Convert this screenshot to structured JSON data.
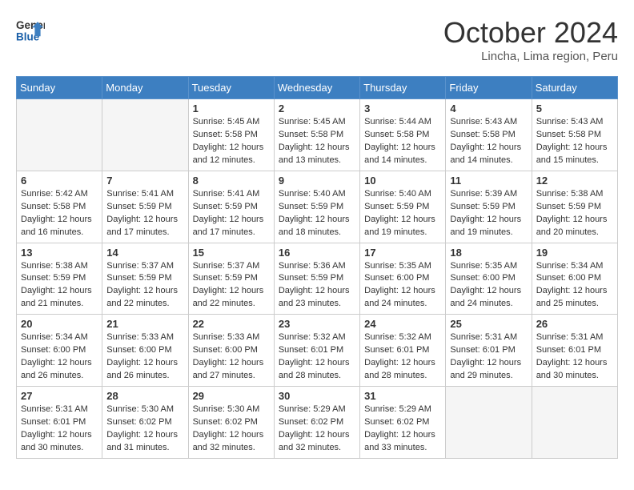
{
  "header": {
    "logo_line1": "General",
    "logo_line2": "Blue",
    "month": "October 2024",
    "location": "Lincha, Lima region, Peru"
  },
  "weekdays": [
    "Sunday",
    "Monday",
    "Tuesday",
    "Wednesday",
    "Thursday",
    "Friday",
    "Saturday"
  ],
  "weeks": [
    [
      {
        "day": "",
        "info": ""
      },
      {
        "day": "",
        "info": ""
      },
      {
        "day": "1",
        "info": "Sunrise: 5:45 AM\nSunset: 5:58 PM\nDaylight: 12 hours\nand 12 minutes."
      },
      {
        "day": "2",
        "info": "Sunrise: 5:45 AM\nSunset: 5:58 PM\nDaylight: 12 hours\nand 13 minutes."
      },
      {
        "day": "3",
        "info": "Sunrise: 5:44 AM\nSunset: 5:58 PM\nDaylight: 12 hours\nand 14 minutes."
      },
      {
        "day": "4",
        "info": "Sunrise: 5:43 AM\nSunset: 5:58 PM\nDaylight: 12 hours\nand 14 minutes."
      },
      {
        "day": "5",
        "info": "Sunrise: 5:43 AM\nSunset: 5:58 PM\nDaylight: 12 hours\nand 15 minutes."
      }
    ],
    [
      {
        "day": "6",
        "info": "Sunrise: 5:42 AM\nSunset: 5:58 PM\nDaylight: 12 hours\nand 16 minutes."
      },
      {
        "day": "7",
        "info": "Sunrise: 5:41 AM\nSunset: 5:59 PM\nDaylight: 12 hours\nand 17 minutes."
      },
      {
        "day": "8",
        "info": "Sunrise: 5:41 AM\nSunset: 5:59 PM\nDaylight: 12 hours\nand 17 minutes."
      },
      {
        "day": "9",
        "info": "Sunrise: 5:40 AM\nSunset: 5:59 PM\nDaylight: 12 hours\nand 18 minutes."
      },
      {
        "day": "10",
        "info": "Sunrise: 5:40 AM\nSunset: 5:59 PM\nDaylight: 12 hours\nand 19 minutes."
      },
      {
        "day": "11",
        "info": "Sunrise: 5:39 AM\nSunset: 5:59 PM\nDaylight: 12 hours\nand 19 minutes."
      },
      {
        "day": "12",
        "info": "Sunrise: 5:38 AM\nSunset: 5:59 PM\nDaylight: 12 hours\nand 20 minutes."
      }
    ],
    [
      {
        "day": "13",
        "info": "Sunrise: 5:38 AM\nSunset: 5:59 PM\nDaylight: 12 hours\nand 21 minutes."
      },
      {
        "day": "14",
        "info": "Sunrise: 5:37 AM\nSunset: 5:59 PM\nDaylight: 12 hours\nand 22 minutes."
      },
      {
        "day": "15",
        "info": "Sunrise: 5:37 AM\nSunset: 5:59 PM\nDaylight: 12 hours\nand 22 minutes."
      },
      {
        "day": "16",
        "info": "Sunrise: 5:36 AM\nSunset: 5:59 PM\nDaylight: 12 hours\nand 23 minutes."
      },
      {
        "day": "17",
        "info": "Sunrise: 5:35 AM\nSunset: 6:00 PM\nDaylight: 12 hours\nand 24 minutes."
      },
      {
        "day": "18",
        "info": "Sunrise: 5:35 AM\nSunset: 6:00 PM\nDaylight: 12 hours\nand 24 minutes."
      },
      {
        "day": "19",
        "info": "Sunrise: 5:34 AM\nSunset: 6:00 PM\nDaylight: 12 hours\nand 25 minutes."
      }
    ],
    [
      {
        "day": "20",
        "info": "Sunrise: 5:34 AM\nSunset: 6:00 PM\nDaylight: 12 hours\nand 26 minutes."
      },
      {
        "day": "21",
        "info": "Sunrise: 5:33 AM\nSunset: 6:00 PM\nDaylight: 12 hours\nand 26 minutes."
      },
      {
        "day": "22",
        "info": "Sunrise: 5:33 AM\nSunset: 6:00 PM\nDaylight: 12 hours\nand 27 minutes."
      },
      {
        "day": "23",
        "info": "Sunrise: 5:32 AM\nSunset: 6:01 PM\nDaylight: 12 hours\nand 28 minutes."
      },
      {
        "day": "24",
        "info": "Sunrise: 5:32 AM\nSunset: 6:01 PM\nDaylight: 12 hours\nand 28 minutes."
      },
      {
        "day": "25",
        "info": "Sunrise: 5:31 AM\nSunset: 6:01 PM\nDaylight: 12 hours\nand 29 minutes."
      },
      {
        "day": "26",
        "info": "Sunrise: 5:31 AM\nSunset: 6:01 PM\nDaylight: 12 hours\nand 30 minutes."
      }
    ],
    [
      {
        "day": "27",
        "info": "Sunrise: 5:31 AM\nSunset: 6:01 PM\nDaylight: 12 hours\nand 30 minutes."
      },
      {
        "day": "28",
        "info": "Sunrise: 5:30 AM\nSunset: 6:02 PM\nDaylight: 12 hours\nand 31 minutes."
      },
      {
        "day": "29",
        "info": "Sunrise: 5:30 AM\nSunset: 6:02 PM\nDaylight: 12 hours\nand 32 minutes."
      },
      {
        "day": "30",
        "info": "Sunrise: 5:29 AM\nSunset: 6:02 PM\nDaylight: 12 hours\nand 32 minutes."
      },
      {
        "day": "31",
        "info": "Sunrise: 5:29 AM\nSunset: 6:02 PM\nDaylight: 12 hours\nand 33 minutes."
      },
      {
        "day": "",
        "info": ""
      },
      {
        "day": "",
        "info": ""
      }
    ]
  ]
}
